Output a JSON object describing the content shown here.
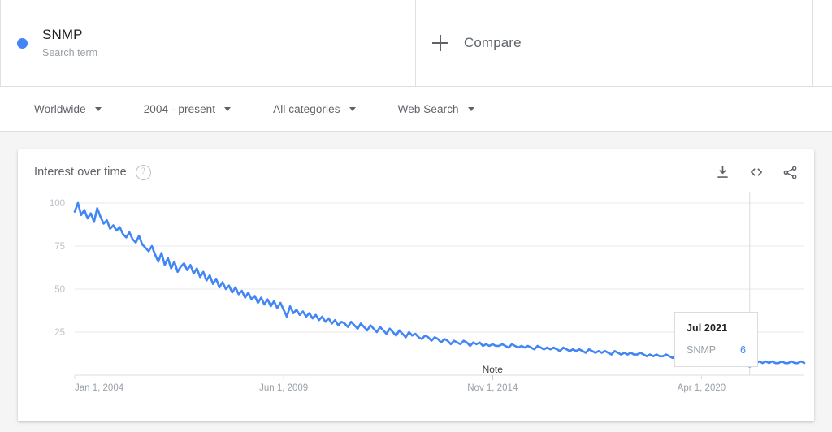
{
  "terms": {
    "primary": {
      "name": "SNMP",
      "subtitle": "Search term",
      "color": "#4285f4"
    },
    "compare": {
      "label": "Compare",
      "icon": "plus-icon"
    }
  },
  "filters": [
    {
      "label": "Worldwide",
      "icon": "chevron-down-icon"
    },
    {
      "label": "2004 - present",
      "icon": "chevron-down-icon"
    },
    {
      "label": "All categories",
      "icon": "chevron-down-icon"
    },
    {
      "label": "Web Search",
      "icon": "chevron-down-icon"
    }
  ],
  "card": {
    "title": "Interest over time",
    "help_icon": "help-circle-icon",
    "actions": [
      {
        "name": "download-icon",
        "label": "Download"
      },
      {
        "name": "embed-icon",
        "label": "Embed"
      },
      {
        "name": "share-icon",
        "label": "Share"
      }
    ]
  },
  "tooltip": {
    "date": "Jul 2021",
    "series_name": "SNMP",
    "value": "6",
    "value_color": "#4285f4"
  },
  "annotation": {
    "label": "Note"
  },
  "chart_data": {
    "type": "line",
    "title": "Interest over time",
    "xlabel": "",
    "ylabel": "",
    "ylim": [
      0,
      100
    ],
    "yticks": [
      25,
      50,
      75,
      100
    ],
    "grid": true,
    "legend": false,
    "line_color": "#4285f4",
    "x_tick_labels": [
      "Jan 1, 2004",
      "Jun 1, 2009",
      "Nov 1, 2014",
      "Apr 1, 2020"
    ],
    "x_tick_positions": [
      0,
      65,
      130,
      195
    ],
    "annotation_label": "Note",
    "annotation_index": 130,
    "hover_index": 210,
    "hover_value": 6,
    "series": [
      {
        "name": "SNMP",
        "color": "#4285f4",
        "values": [
          95,
          100,
          93,
          96,
          91,
          94,
          89,
          97,
          92,
          88,
          90,
          85,
          87,
          84,
          86,
          82,
          80,
          83,
          79,
          77,
          81,
          76,
          74,
          72,
          75,
          70,
          66,
          71,
          64,
          68,
          62,
          66,
          60,
          63,
          65,
          61,
          64,
          59,
          62,
          57,
          60,
          55,
          58,
          53,
          56,
          51,
          54,
          50,
          52,
          48,
          51,
          47,
          49,
          45,
          48,
          44,
          46,
          42,
          45,
          41,
          44,
          40,
          43,
          39,
          42,
          38,
          34,
          40,
          36,
          38,
          35,
          37,
          34,
          36,
          33,
          35,
          32,
          34,
          31,
          33,
          30,
          32,
          29,
          31,
          30,
          28,
          31,
          29,
          27,
          30,
          28,
          26,
          29,
          27,
          25,
          28,
          26,
          24,
          27,
          25,
          23,
          26,
          24,
          22,
          25,
          23,
          24,
          22,
          21,
          23,
          22,
          20,
          22,
          21,
          19,
          21,
          20,
          18,
          20,
          19,
          18,
          20,
          19,
          17,
          19,
          18,
          19,
          17,
          18,
          17,
          18,
          17,
          17,
          18,
          17,
          16,
          18,
          17,
          16,
          17,
          16,
          17,
          16,
          15,
          17,
          16,
          15,
          16,
          15,
          16,
          15,
          14,
          16,
          15,
          14,
          15,
          14,
          15,
          14,
          13,
          15,
          14,
          13,
          14,
          13,
          14,
          13,
          12,
          14,
          13,
          12,
          13,
          12,
          13,
          12,
          12,
          13,
          12,
          11,
          12,
          11,
          12,
          11,
          11,
          12,
          11,
          10,
          11,
          10,
          11,
          10,
          10,
          11,
          10,
          9,
          10,
          9,
          10,
          9,
          9,
          10,
          9,
          8,
          9,
          8,
          9,
          6,
          8,
          7,
          8,
          7,
          8,
          7,
          8,
          7,
          8,
          7,
          8,
          7,
          7,
          8,
          7,
          7,
          8,
          7,
          7,
          8,
          7
        ]
      }
    ]
  }
}
